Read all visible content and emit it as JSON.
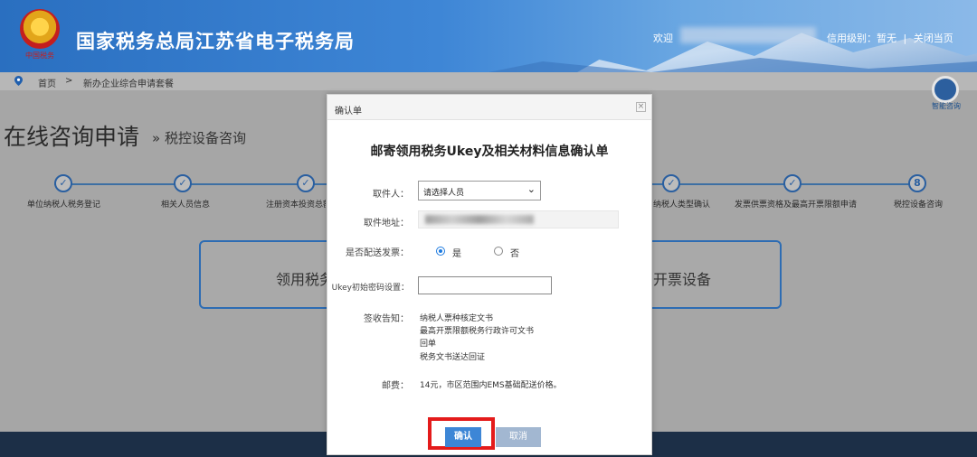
{
  "header": {
    "site_title": "国家税务总局江苏省电子税务局",
    "emblem_sub": "中国税务",
    "welcome": "欢迎",
    "credit_label": "信用级别：暂无",
    "sep": "|",
    "close_page": "关闭当页"
  },
  "breadcrumb": {
    "home": "首页",
    "sep": ">",
    "current": "新办企业综合申请套餐"
  },
  "page": {
    "title": "在线咨询申请",
    "subtitle": "» 税控设备咨询",
    "side_service": "智能咨询",
    "steps": [
      {
        "label": "单位纳税人税务登记",
        "mark": "✓"
      },
      {
        "label": "相关人员信息",
        "mark": "✓"
      },
      {
        "label": "注册资本投资总额",
        "mark": "✓"
      },
      {
        "label": "纳税人类型确认",
        "mark": "✓"
      },
      {
        "label": "发票供票资格及最高开票限额申请",
        "mark": "✓"
      },
      {
        "label": "税控设备咨询",
        "mark": "8"
      }
    ],
    "card_left_text": "领用税务",
    "card_right_text": "开票设备"
  },
  "modal": {
    "header_title": "确认单",
    "close_glyph": "×",
    "title": "邮寄领用税务Ukey及相关材料信息确认单",
    "recipient_label": "取件人：",
    "recipient_value": "请选择人员",
    "address_label": "取件地址：",
    "invoice_label": "是否配送发票：",
    "invoice_yes": "是",
    "invoice_no": "否",
    "invoice_selected": "是",
    "pwd_label": "Ukey初始密码设置：",
    "notice_label": "签收告知：",
    "notice_items": [
      "纳税人票种核定文书",
      "最高开票限额税务行政许可文书",
      "回单",
      "税务文书送达回证"
    ],
    "postage_label": "邮费：",
    "postage_value": "14元，市区范围内EMS基础配送价格。",
    "confirm_btn": "确认",
    "cancel_btn": "取消"
  }
}
